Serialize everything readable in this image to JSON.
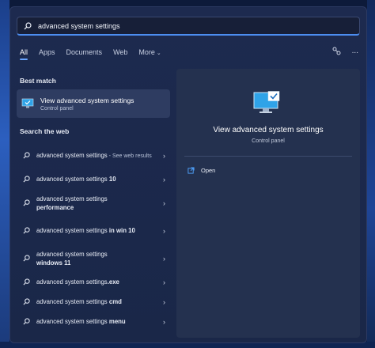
{
  "search": {
    "query": "advanced system settings"
  },
  "tabs": [
    {
      "label": "All",
      "active": true
    },
    {
      "label": "Apps"
    },
    {
      "label": "Documents"
    },
    {
      "label": "Web"
    },
    {
      "label": "More"
    }
  ],
  "icons": {
    "share": "share-icon",
    "ellipsis": "..."
  },
  "best_match": {
    "heading": "Best match",
    "title": "View advanced system settings",
    "subtitle": "Control panel"
  },
  "web": {
    "heading": "Search the web",
    "items": [
      {
        "normal": "advanced system settings",
        "bold": "",
        "dim": " - See web results"
      },
      {
        "normal": "advanced system settings ",
        "bold": "10",
        "dim": ""
      },
      {
        "normal": "advanced system settings ",
        "bold": "performance",
        "dim": ""
      },
      {
        "normal": "advanced system settings ",
        "bold": "in win 10",
        "dim": ""
      },
      {
        "normal": "advanced system settings ",
        "bold": "windows 11",
        "dim": ""
      },
      {
        "normal": "advanced system settings",
        "bold": ".exe",
        "dim": ""
      },
      {
        "normal": "advanced system settings ",
        "bold": "cmd",
        "dim": ""
      },
      {
        "normal": "advanced system settings ",
        "bold": "menu",
        "dim": ""
      }
    ]
  },
  "preview": {
    "title": "View advanced system settings",
    "subtitle": "Control panel",
    "action": "Open"
  },
  "colors": {
    "accent": "#4c8df0",
    "panel": "#1d2a4f",
    "selected": "#2e3c61"
  }
}
